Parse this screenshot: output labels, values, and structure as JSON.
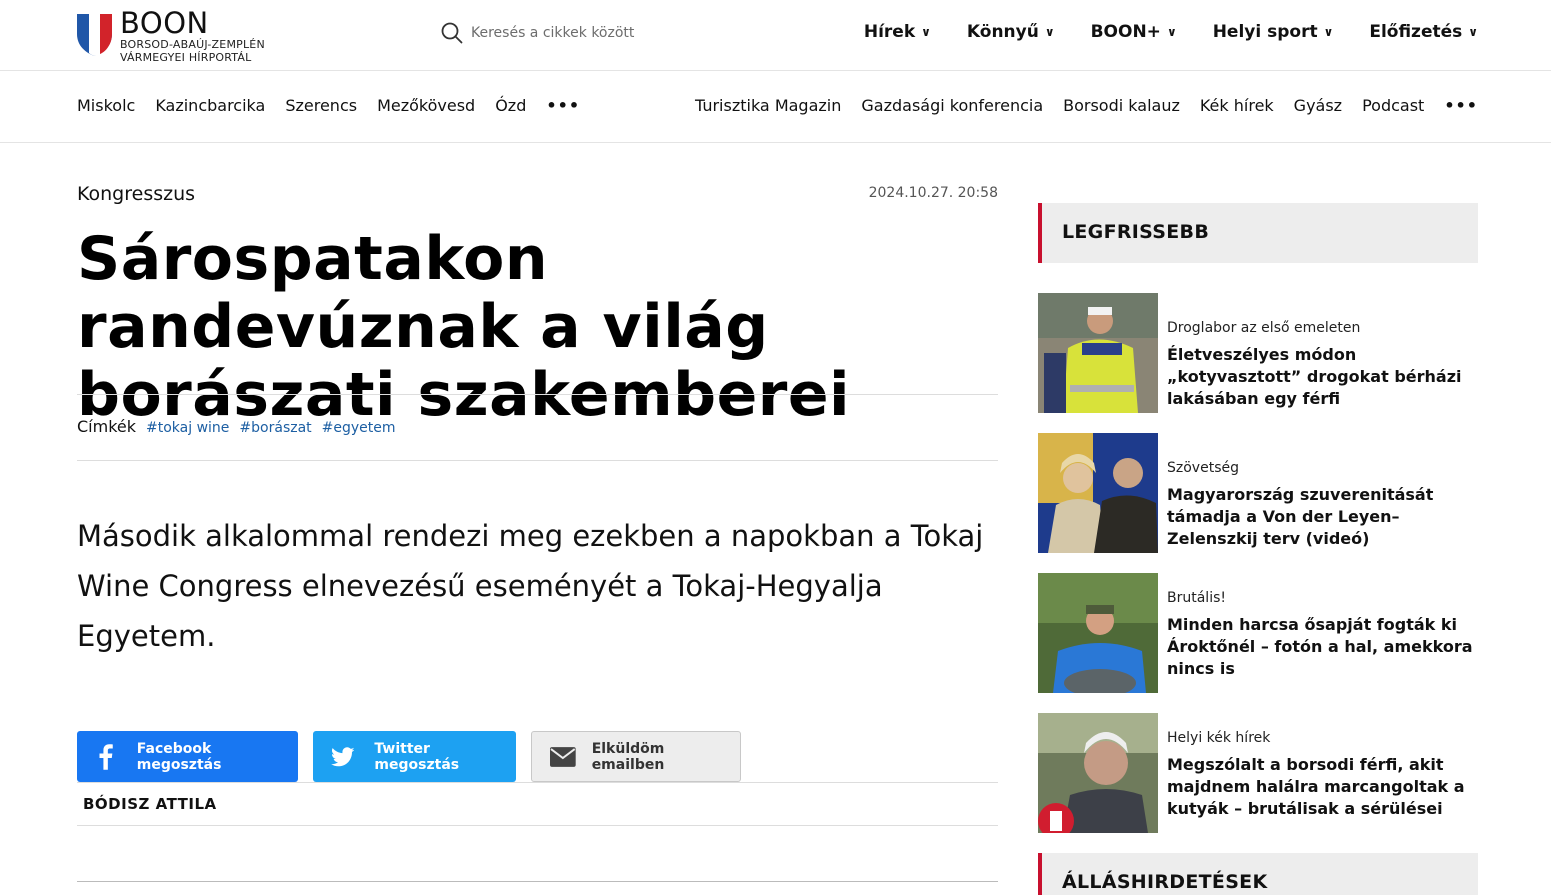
{
  "header": {
    "logo_name": "BOON",
    "logo_sub1": "BORSOD-ABAÚJ-ZEMPLÉN",
    "logo_sub2": "VÁRMEGYEI HÍRPORTÁL",
    "search_placeholder": "Keresés a cikkek között",
    "nav": [
      {
        "label": "Hírek"
      },
      {
        "label": "Könnyű"
      },
      {
        "label": "BOON+"
      },
      {
        "label": "Helyi sport"
      },
      {
        "label": "Előfizetés"
      }
    ]
  },
  "subnav": {
    "left": [
      "Miskolc",
      "Kazincbarcika",
      "Szerencs",
      "Mezőkövesd",
      "Ózd"
    ],
    "right": [
      "Turisztika Magazin",
      "Gazdasági konferencia",
      "Borsodi kalauz",
      "Kék hírek",
      "Gyász",
      "Podcast"
    ],
    "more": "•••"
  },
  "article": {
    "category": "Kongresszus",
    "date": "2024.10.27. 20:58",
    "headline": "Sárospatakon randevúznak a világ borászati szakemberei",
    "tags_label": "Címkék",
    "tags": [
      "#tokaj wine",
      "#borászat",
      "#egyetem"
    ],
    "lead": "Második alkalommal rendezi meg ezekben a napokban a Tokaj Wine Congress elnevezésű eseményét a Tokaj-Hegyalja Egyetem.",
    "share": {
      "facebook": "Facebook megosztás",
      "twitter": "Twitter megosztás",
      "email": "Elküldöm emailben"
    },
    "author": "BÓDISZ ATTILA"
  },
  "sidebar": {
    "latest_title": "LEGFRISSEBB",
    "jobs_title": "ÁLLÁSHIRDETÉSEK",
    "items": [
      {
        "category": "Droglabor az első emeleten",
        "title": "Életveszélyes módon „kotyvasztott” drogokat bérházi lakásában egy férfi"
      },
      {
        "category": "Szövetség",
        "title": "Magyarország szuverenitását támadja a Von der Leyen–Zelenszkij terv (videó)"
      },
      {
        "category": "Brutális!",
        "title": "Minden harcsa ősapját fogták ki Ároktőnél – fotón a hal, amekkora nincs is"
      },
      {
        "category": "Helyi kék hírek",
        "title": "Megszólalt a borsodi férfi, akit majdnem halálra marcangoltak a kutyák – brutálisak a sérülései"
      }
    ]
  },
  "colors": {
    "accent_red": "#c8102e",
    "link_blue": "#1d5fa3",
    "facebook": "#1877f2",
    "twitter": "#1da1f2"
  }
}
